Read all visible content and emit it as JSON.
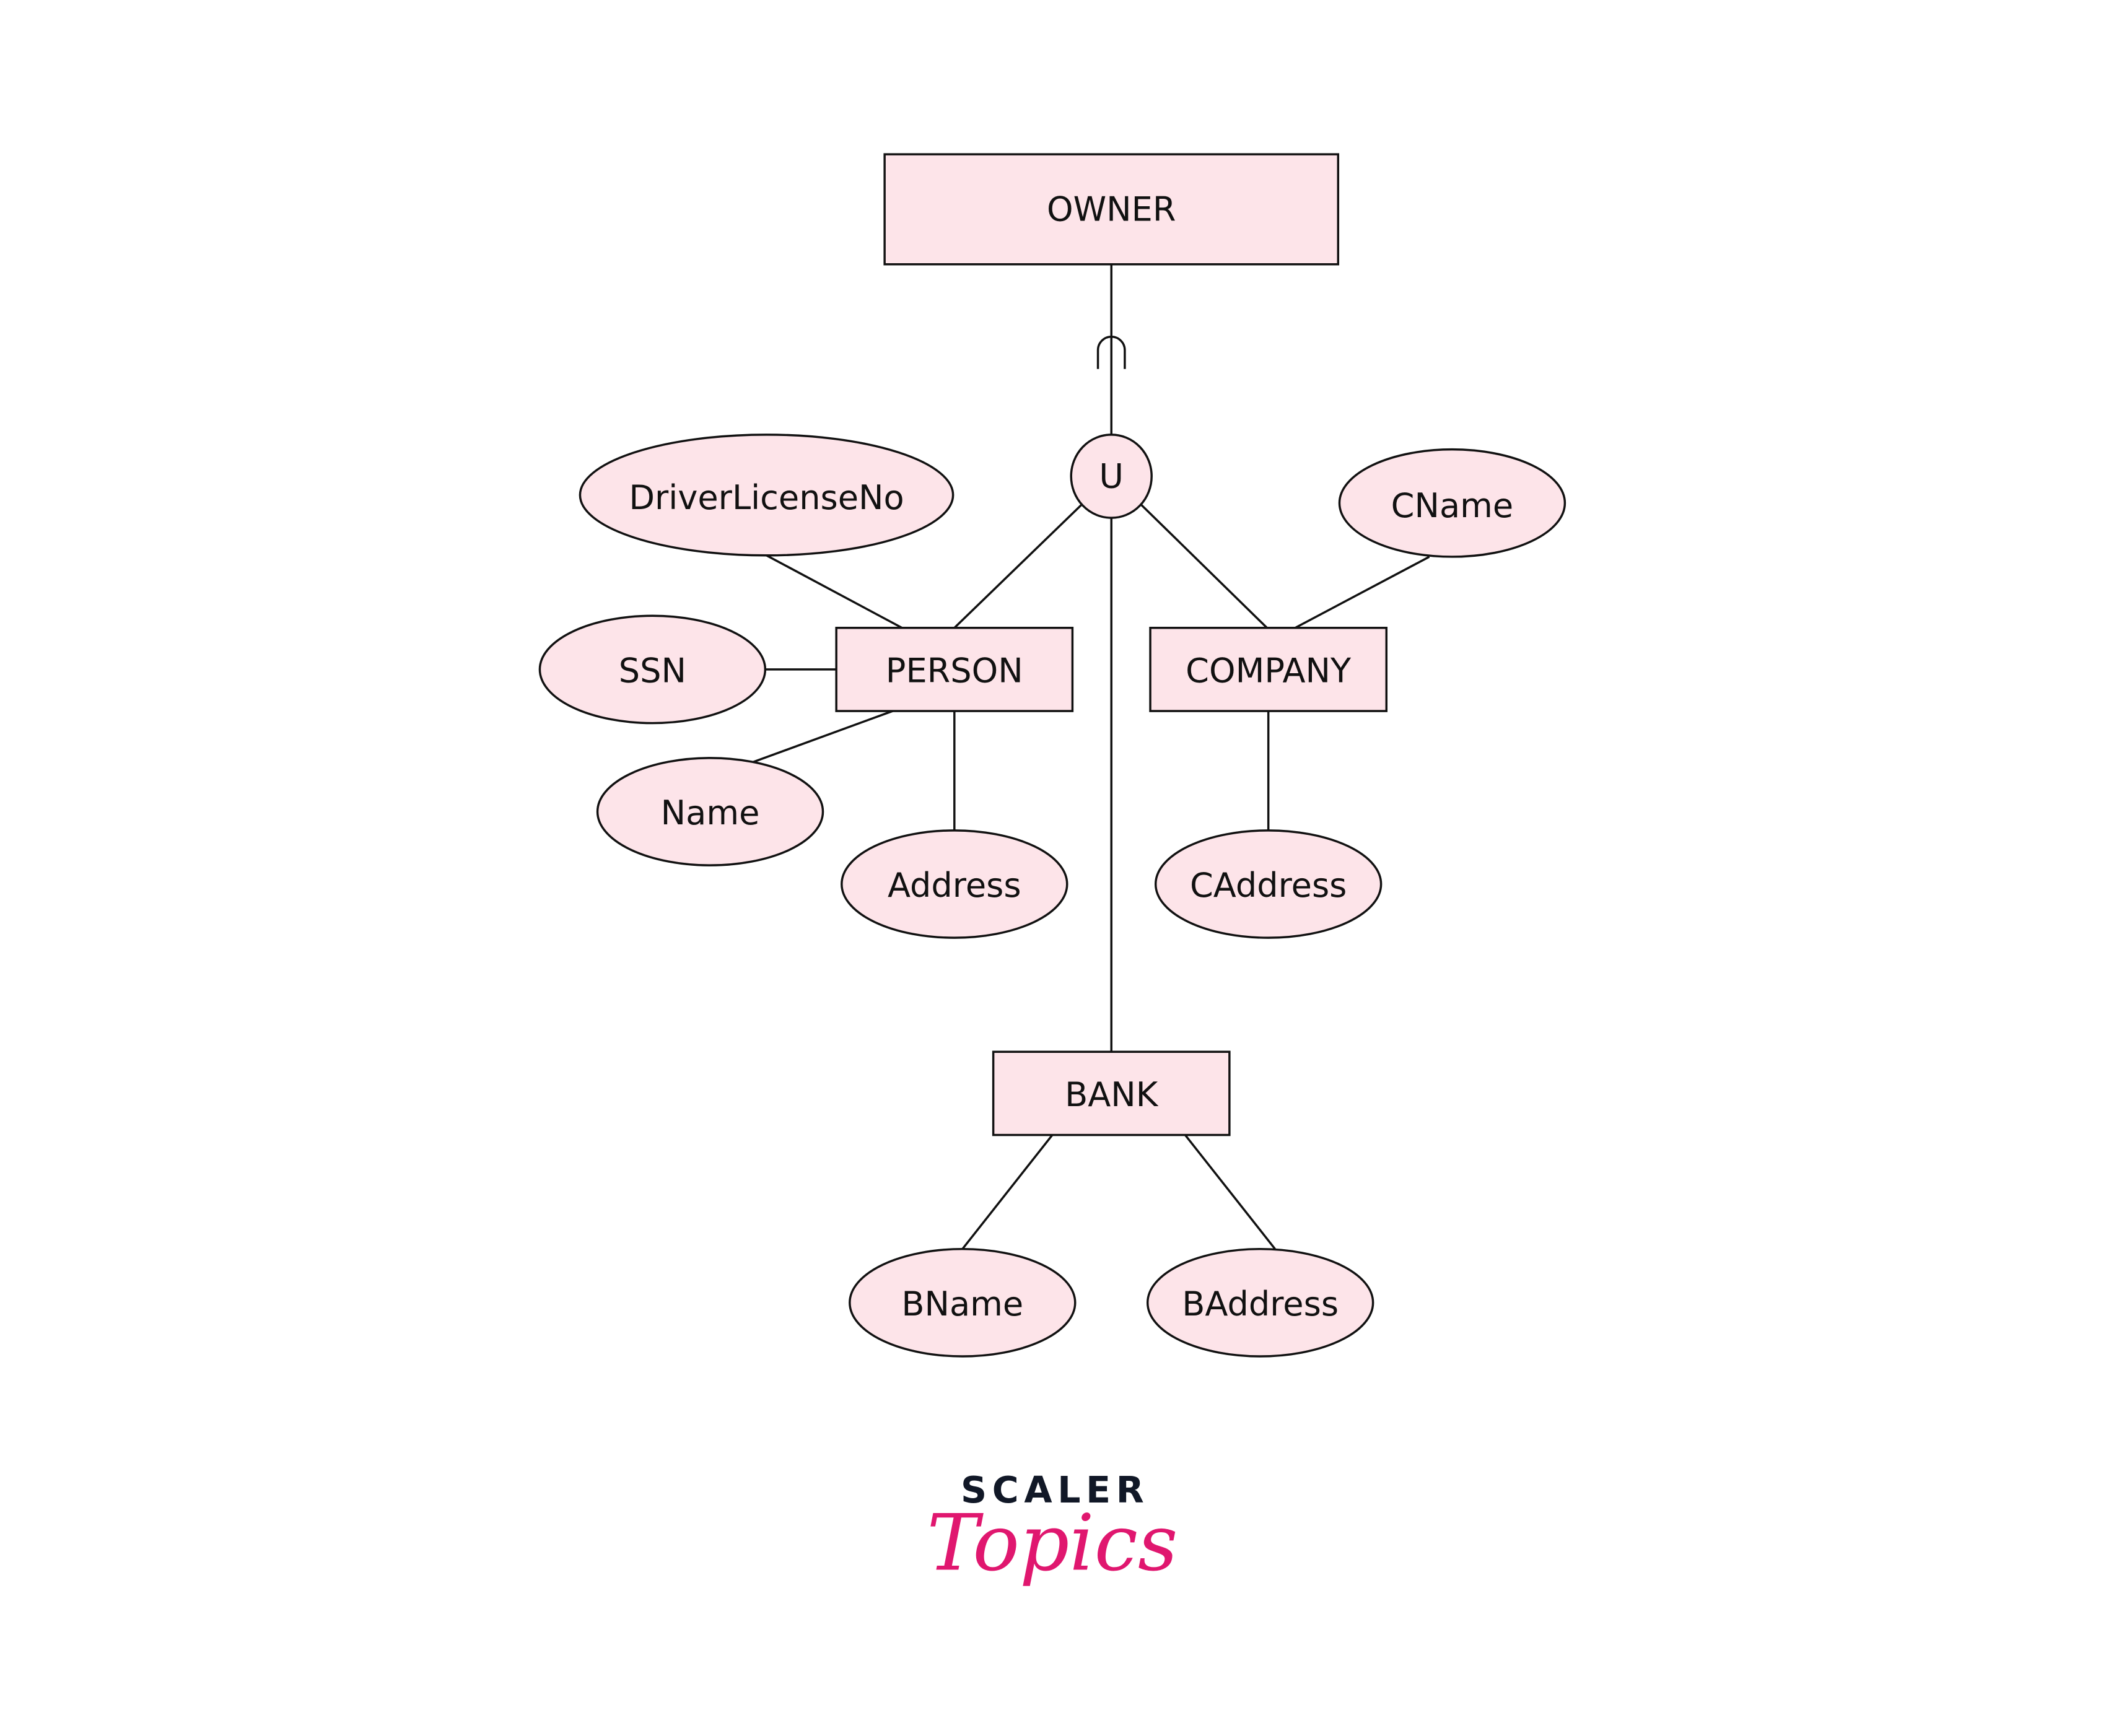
{
  "diagram": {
    "type": "ER diagram (union / category type)",
    "entities": {
      "owner": "OWNER",
      "person": "PERSON",
      "company": "COMPANY",
      "bank": "BANK"
    },
    "union_symbol": "U",
    "subset_symbol": "⊂",
    "attributes": {
      "person": [
        "DriverLicenseNo",
        "SSN",
        "Name",
        "Address"
      ],
      "company": [
        "CName",
        "CAddress"
      ],
      "bank": [
        "BName",
        "BAddress"
      ]
    },
    "relationships": [
      {
        "from": "OWNER",
        "to": "U",
        "notation": "subset"
      },
      {
        "from": "U",
        "to": "PERSON"
      },
      {
        "from": "U",
        "to": "COMPANY"
      },
      {
        "from": "U",
        "to": "BANK"
      }
    ],
    "colors": {
      "fill": "#fde4e9",
      "stroke": "#111111"
    }
  },
  "logo": {
    "line1": "SCALER",
    "line2": "Topics",
    "colors": {
      "line1": "#111827",
      "line2": "#e0176f"
    }
  }
}
